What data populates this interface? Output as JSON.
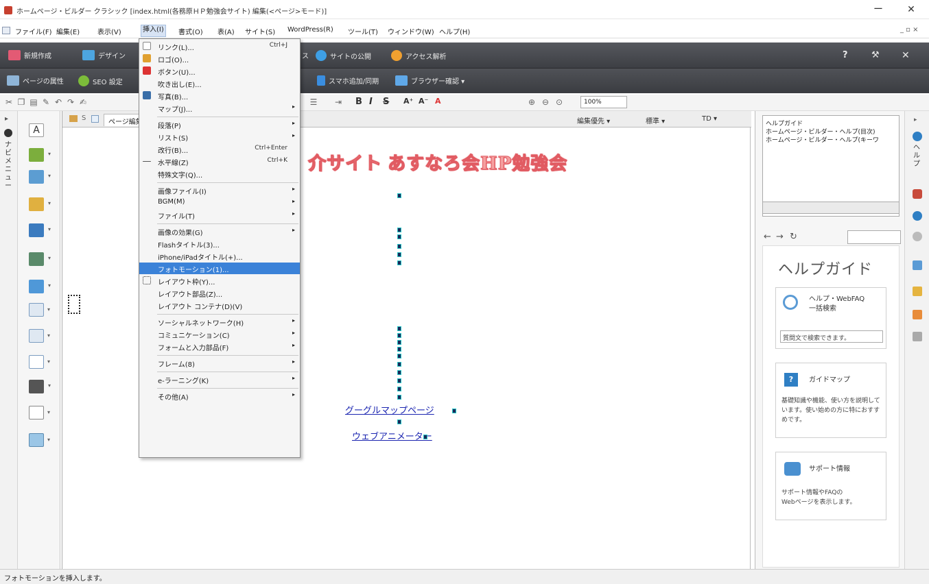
{
  "titlebar": {
    "title": "ホームページ・ビルダー クラシック [index.html(各務原ＨＰ勉強会サイト) 編集(<ページ>モード)]",
    "min": "ー",
    "close": "✕",
    "mdi": "_ ▫ ×"
  },
  "menubar": {
    "items": [
      "ファイル(F)",
      "編集(E)",
      "表示(V)",
      "挿入(I)",
      "書式(O)",
      "表(A)",
      "サイト(S)",
      "WordPress(R)",
      "ツール(T)",
      "ウィンドウ(W)",
      "ヘルプ(H)"
    ]
  },
  "toolbar1": {
    "new": "新規作成",
    "design": "デザイン",
    "publish": "サイトの公開",
    "analytics": "アクセス解析",
    "help_icon": "?",
    "settings_icon": "⚒",
    "close_icon": "✕",
    "hidden_suffix": "ス"
  },
  "toolbar2": {
    "page_props": "ページの属性",
    "seo": "SEO 設定",
    "smartphone": "スマホ追加/同期",
    "browser": "ブラウザー確認 ▾"
  },
  "toolbar3": {
    "zoom": "100%"
  },
  "leftnav": {
    "label": "ナビメニュー"
  },
  "editor": {
    "tab_label": "ページ編集",
    "edit_priority": "編集優先 ▾",
    "standard": "標準 ▾",
    "td": "TD ▾",
    "headline_part1": "介サイト",
    "headline_part2": "あすなろ会HP勉強会",
    "link1": "グーグルマップページ",
    "link2": "ウェブアニメーター"
  },
  "insert_menu": {
    "items": [
      {
        "label": "リンク(L)...",
        "shortcut": "Ctrl+J",
        "sub": false
      },
      {
        "label": "ロゴ(O)...",
        "shortcut": "",
        "sub": false
      },
      {
        "label": "ボタン(U)...",
        "shortcut": "",
        "sub": false
      },
      {
        "label": "吹き出し(E)...",
        "shortcut": "",
        "sub": false
      },
      {
        "label": "写真(B)...",
        "shortcut": "",
        "sub": false
      },
      {
        "label": "マップ(J)...",
        "shortcut": "",
        "sub": true
      },
      {
        "label": "段落(P)",
        "shortcut": "",
        "sub": true
      },
      {
        "label": "リスト(S)",
        "shortcut": "",
        "sub": true
      },
      {
        "label": "改行(B)...",
        "shortcut": "Ctrl+Enter",
        "sub": false
      },
      {
        "label": "水平線(Z)",
        "shortcut": "Ctrl+K",
        "sub": false
      },
      {
        "label": "特殊文字(Q)...",
        "shortcut": "",
        "sub": false
      },
      {
        "label": "画像ファイル(I)",
        "shortcut": "",
        "sub": true
      },
      {
        "label": "BGM(M)",
        "shortcut": "",
        "sub": true
      },
      {
        "label": "ファイル(T)",
        "shortcut": "",
        "sub": true
      },
      {
        "label": "画像の効果(G)",
        "shortcut": "",
        "sub": true
      },
      {
        "label": "Flashタイトル(3)...",
        "shortcut": "",
        "sub": false
      },
      {
        "label": "iPhone/iPadタイトル(+)...",
        "shortcut": "",
        "sub": false
      },
      {
        "label": "フォトモーション(1)...",
        "shortcut": "",
        "sub": false
      },
      {
        "label": "レイアウト枠(Y)...",
        "shortcut": "",
        "sub": false
      },
      {
        "label": "レイアウト部品(Z)...",
        "shortcut": "",
        "sub": false
      },
      {
        "label": "レイアウト コンテナ(D)(V)",
        "shortcut": "",
        "sub": false
      },
      {
        "label": "ソーシャルネットワーク(H)",
        "shortcut": "",
        "sub": true
      },
      {
        "label": "コミュニケーション(C)",
        "shortcut": "",
        "sub": true
      },
      {
        "label": "フォームと入力部品(F)",
        "shortcut": "",
        "sub": true
      },
      {
        "label": "フレーム(8)",
        "shortcut": "",
        "sub": true
      },
      {
        "label": "e-ラーニング(K)",
        "shortcut": "",
        "sub": true
      },
      {
        "label": "その他(A)",
        "shortcut": "",
        "sub": true
      }
    ]
  },
  "right": {
    "tree": [
      "ヘルプガイド",
      "ホームページ・ビルダー・ヘルプ(目次)",
      "ホームページ・ビルダー・ヘルプ(キーワ"
    ],
    "guide_title": "ヘルプガイド",
    "card1_title": "ヘルプ・WebFAQ\n一括検索",
    "card1_search": "質問文で検索できます。",
    "card2_title": "ガイドマップ",
    "card2_desc": "基礎知識や機能、使い方を説明しています。使い始めの方に特におすすめです。",
    "card3_title": "サポート情報",
    "card3_desc": "サポート情報やFAQの\nWebページを表示します。",
    "rstrip_label": "ヘルプ"
  },
  "status": {
    "text": "フォトモーションを挿入します。"
  },
  "colors": {
    "accent": "#3b82d8",
    "toolbar": "#48494e",
    "headline": "#f5a0a0"
  }
}
